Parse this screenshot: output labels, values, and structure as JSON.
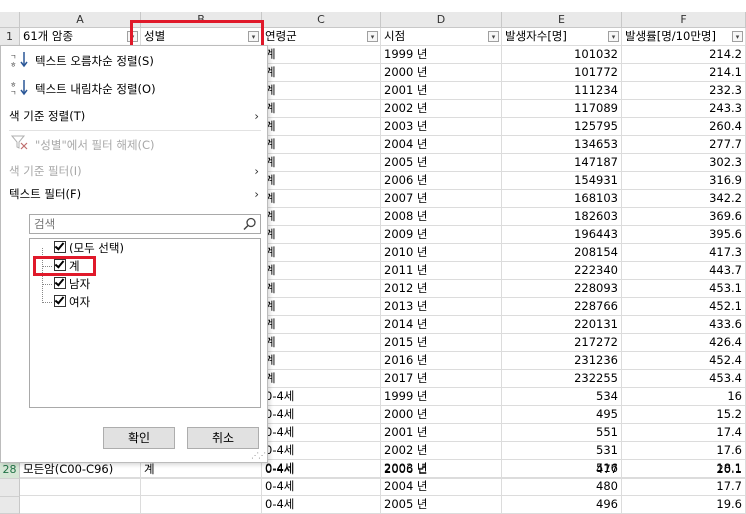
{
  "columns": [
    {
      "letter": "A",
      "header": "61개 암종"
    },
    {
      "letter": "B",
      "header": "성별"
    },
    {
      "letter": "C",
      "header": "연령군"
    },
    {
      "letter": "D",
      "header": "시점"
    },
    {
      "letter": "E",
      "header": "발생자수[명]"
    },
    {
      "letter": "F",
      "header": "발생률[명/10만명]"
    }
  ],
  "header_row_number": "1",
  "rows": [
    {
      "c": "계",
      "d": "1999 년",
      "e": "101032",
      "f": "214.2"
    },
    {
      "c": "계",
      "d": "2000 년",
      "e": "101772",
      "f": "214.1"
    },
    {
      "c": "계",
      "d": "2001 년",
      "e": "111234",
      "f": "232.3"
    },
    {
      "c": "계",
      "d": "2002 년",
      "e": "117089",
      "f": "243.3"
    },
    {
      "c": "계",
      "d": "2003 년",
      "e": "125795",
      "f": "260.4"
    },
    {
      "c": "계",
      "d": "2004 년",
      "e": "134653",
      "f": "277.7"
    },
    {
      "c": "계",
      "d": "2005 년",
      "e": "147187",
      "f": "302.3"
    },
    {
      "c": "계",
      "d": "2006 년",
      "e": "154931",
      "f": "316.9"
    },
    {
      "c": "계",
      "d": "2007 년",
      "e": "168103",
      "f": "342.2"
    },
    {
      "c": "계",
      "d": "2008 년",
      "e": "182603",
      "f": "369.6"
    },
    {
      "c": "계",
      "d": "2009 년",
      "e": "196443",
      "f": "395.6"
    },
    {
      "c": "계",
      "d": "2010 년",
      "e": "208154",
      "f": "417.3"
    },
    {
      "c": "계",
      "d": "2011 년",
      "e": "222340",
      "f": "443.7"
    },
    {
      "c": "계",
      "d": "2012 년",
      "e": "228093",
      "f": "453.1"
    },
    {
      "c": "계",
      "d": "2013 년",
      "e": "228766",
      "f": "452.1"
    },
    {
      "c": "계",
      "d": "2014 년",
      "e": "220131",
      "f": "433.6"
    },
    {
      "c": "계",
      "d": "2015 년",
      "e": "217272",
      "f": "426.4"
    },
    {
      "c": "계",
      "d": "2016 년",
      "e": "231236",
      "f": "452.4"
    },
    {
      "c": "계",
      "d": "2017 년",
      "e": "232255",
      "f": "453.4"
    },
    {
      "c": "0-4세",
      "d": "1999 년",
      "e": "534",
      "f": "16"
    },
    {
      "c": "0-4세",
      "d": "2000 년",
      "e": "495",
      "f": "15.2"
    },
    {
      "c": "0-4세",
      "d": "2001 년",
      "e": "551",
      "f": "17.4"
    },
    {
      "c": "0-4세",
      "d": "2002 년",
      "e": "531",
      "f": "17.6"
    },
    {
      "c": "0-4세",
      "d": "2003 년",
      "e": "516",
      "f": "18.1"
    },
    {
      "c": "0-4세",
      "d": "2004 년",
      "e": "480",
      "f": "17.7"
    },
    {
      "c": "0-4세",
      "d": "2005 년",
      "e": "496",
      "f": "19.6"
    },
    {
      "c": "0-4세",
      "d": "2006 년",
      "e": "477",
      "f": "20.1"
    }
  ],
  "bottom_row": {
    "num": "28",
    "a": "모든암(C00-C96)",
    "b": "계"
  },
  "filter_menu": {
    "sort_asc": "텍스트 오름차순 정렬(S)",
    "sort_desc": "텍스트 내림차순 정렬(O)",
    "sort_by_color": "색 기준 정렬(T)",
    "clear_filter": "\"성별\"에서 필터 해제(C)",
    "filter_by_color": "색 기준 필터(I)",
    "text_filter": "텍스트 필터(F)",
    "search_placeholder": "검색",
    "items": [
      "(모두 선택)",
      "계",
      "남자",
      "여자"
    ],
    "ok": "확인",
    "cancel": "취소"
  },
  "highlight_color": "#e0192a"
}
